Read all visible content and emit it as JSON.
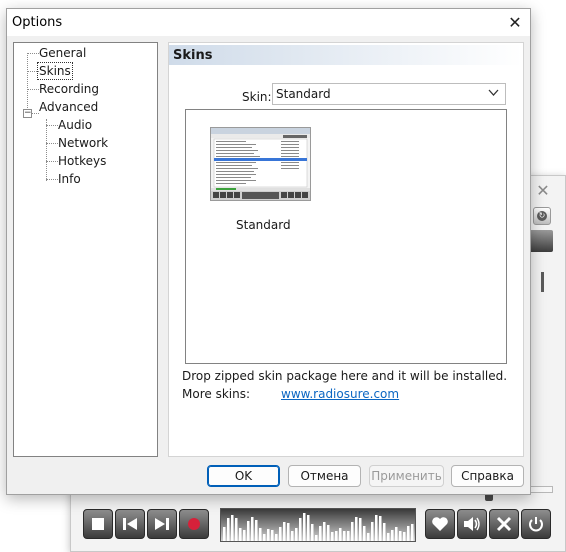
{
  "dialog": {
    "title": "Options",
    "tree": {
      "items": [
        {
          "label": "General"
        },
        {
          "label": "Skins"
        },
        {
          "label": "Recording"
        },
        {
          "label": "Advanced"
        },
        {
          "label": "Audio"
        },
        {
          "label": "Network"
        },
        {
          "label": "Hotkeys"
        },
        {
          "label": "Info"
        }
      ],
      "selected": "Skins",
      "expanded": "Advanced"
    },
    "panel": {
      "title": "Skins",
      "skin_label": "Skin:",
      "skin_selected": "Standard",
      "preview_caption": "Standard",
      "drop_text": "Drop zipped skin package here and it will be installed.",
      "more_label": "More skins:",
      "more_link": "www.radiosure.com"
    },
    "buttons": {
      "ok": "OK",
      "cancel": "Отмена",
      "apply": "Применить",
      "help": "Справка"
    }
  },
  "player": {
    "icons": [
      "close-icon",
      "stop-icon",
      "previous-icon",
      "next-icon",
      "record-icon",
      "favorite-heart-icon",
      "volume-icon",
      "tools-icon",
      "power-icon"
    ],
    "colors": {
      "record": "#d6213a",
      "accent_green": "#3ca13c",
      "link": "#0b66c2"
    }
  }
}
